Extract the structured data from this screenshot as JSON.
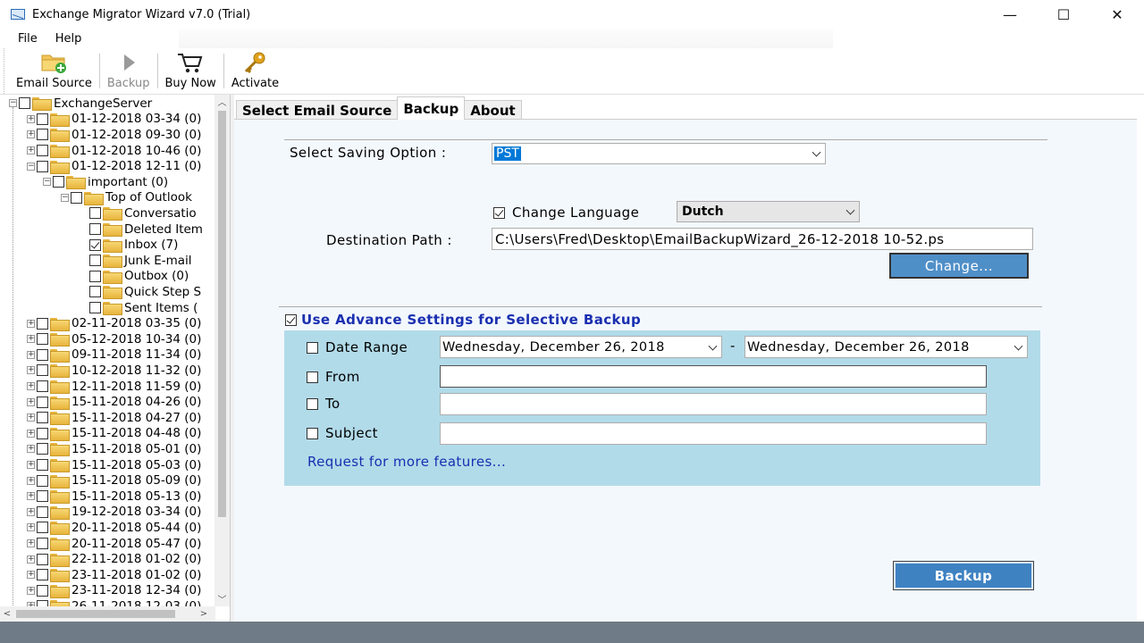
{
  "window": {
    "title": "Exchange Migrator Wizard v7.0 (Trial)",
    "controls": [
      "—",
      "☐",
      "✕"
    ]
  },
  "menu": {
    "items": [
      "File",
      "Help"
    ]
  },
  "toolbar": {
    "email_source": "Email Source",
    "backup": "Backup",
    "buy_now": "Buy Now",
    "activate": "Activate"
  },
  "tree": {
    "root": "ExchangeServer",
    "items": [
      "01-12-2018 03-34 (0)",
      "01-12-2018 09-30 (0)",
      "01-12-2018 10-46 (0)",
      "01-12-2018 12-11 (0)",
      "important (0)",
      "Top of Outlook",
      "Conversatio",
      "Deleted Item",
      "Inbox (7)",
      "Junk E-mail",
      "Outbox (0)",
      "Quick Step S",
      "Sent Items (",
      "02-11-2018 03-35 (0)",
      "05-12-2018 10-34 (0)",
      "09-11-2018 11-34 (0)",
      "10-12-2018 11-32 (0)",
      "12-11-2018 11-59 (0)",
      "15-11-2018 04-26 (0)",
      "15-11-2018 04-27 (0)",
      "15-11-2018 04-48 (0)",
      "15-11-2018 05-01 (0)",
      "15-11-2018 05-03 (0)",
      "15-11-2018 05-09 (0)",
      "15-11-2018 05-13 (0)",
      "19-12-2018 03-34 (0)",
      "20-11-2018 05-44 (0)",
      "20-11-2018 05-47 (0)",
      "22-11-2018 01-02 (0)",
      "23-11-2018 01-02 (0)",
      "23-11-2018 12-34 (0)",
      "26-11-2018 12-03 (0)"
    ]
  },
  "tabs": [
    "Select Email Source",
    "Backup",
    "About"
  ],
  "backup": {
    "saving_option_label": "Select Saving Option :",
    "saving_option_value": "PST",
    "change_language_label": "Change Language",
    "language_value": "Dutch",
    "destination_label": "Destination Path :",
    "destination_value": "C:\\Users\\Fred\\Desktop\\EmailBackupWizard_26-12-2018 10-52.ps",
    "change_button": "Change...",
    "advance_settings_label": "Use Advance Settings for Selective Backup",
    "date_range_label": "Date Range",
    "date_from_value": "Wednesday,  December  26, 2018",
    "date_sep": "-",
    "date_to_value": "Wednesday,  December  26, 2018",
    "from_label": "From",
    "to_label": "To",
    "subject_label": "Subject",
    "more_features_link": "Request for more features...",
    "backup_button": "Backup"
  },
  "colors": {
    "accent": "#0078d7",
    "button": "#4f8fc8",
    "panel": "#b2dbe9",
    "link": "#1a2fb0"
  }
}
